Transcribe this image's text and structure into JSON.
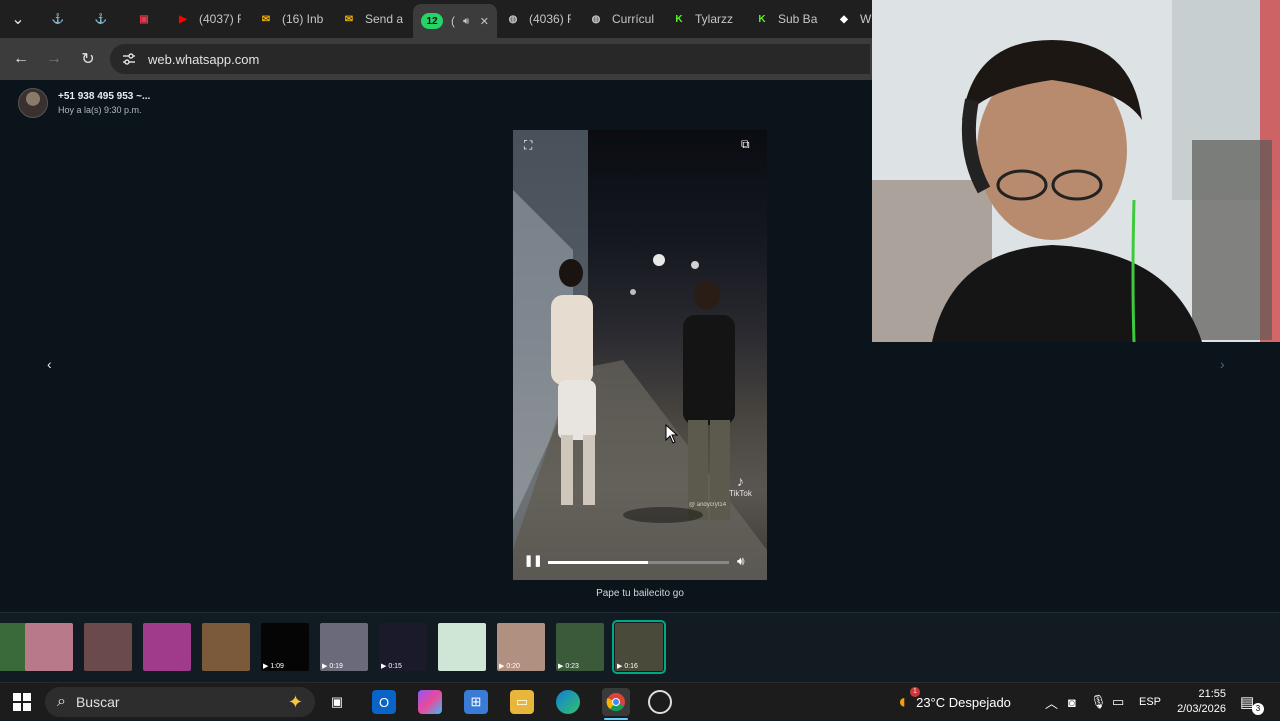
{
  "browser": {
    "tabs": [
      {
        "label": "",
        "icon": "anchor-icon",
        "color": "#ffffff"
      },
      {
        "label": "",
        "icon": "anchor-icon",
        "color": "#ffffff"
      },
      {
        "label": "",
        "icon": "app-icon",
        "color": "#e8364b"
      },
      {
        "label": "(4037) F",
        "icon": "youtube-icon",
        "color": "#ff0000"
      },
      {
        "label": "(16) Inb",
        "icon": "mail-icon",
        "color": "#f4b400"
      },
      {
        "label": "Send a",
        "icon": "mail-icon",
        "color": "#f4b400"
      },
      {
        "label": "(",
        "icon": "whatsapp-icon",
        "color": "#25d366",
        "badge": "12",
        "active": true
      },
      {
        "label": "(4036) F",
        "icon": "globe-icon",
        "color": "#c4c7c5"
      },
      {
        "label": "Currícul",
        "icon": "globe-icon",
        "color": "#c4c7c5"
      },
      {
        "label": "Tylarzz",
        "icon": "kick-icon",
        "color": "#53fc18"
      },
      {
        "label": "Sub Ba",
        "icon": "kick-icon",
        "color": "#53fc18"
      },
      {
        "label": "Wi",
        "icon": "diamond-icon",
        "color": "#ffffff"
      }
    ],
    "url": "web.whatsapp.com"
  },
  "viewer": {
    "sender_name": "+51 938 495 953 ~...",
    "sender_time": "Hoy a la(s) 9:30 p.m.",
    "caption": "Pape tu bailecito go",
    "video": {
      "watermark": "TikTok",
      "handle": "@ andycryt14",
      "progress": 0.55
    }
  },
  "thumbnails": [
    {
      "duration": "",
      "color": "#3a6a3a"
    },
    {
      "duration": "",
      "color": "#b87a8a"
    },
    {
      "duration": "",
      "color": "#6a4a4a"
    },
    {
      "duration": "",
      "color": "#a03a8a"
    },
    {
      "duration": "",
      "color": "#7a5a3a"
    },
    {
      "duration": "1:09",
      "color": "#050505"
    },
    {
      "duration": "0:19",
      "color": "#6a6a7a"
    },
    {
      "duration": "0:15",
      "color": "#1a1a2a"
    },
    {
      "duration": "",
      "color": "#cfe6d6"
    },
    {
      "duration": "0:20",
      "color": "#b09080"
    },
    {
      "duration": "0:23",
      "color": "#3a5a3a"
    },
    {
      "duration": "0:16",
      "color": "#4a4a3a",
      "selected": true
    }
  ],
  "taskbar": {
    "search_label": "Buscar",
    "weather": "23°C  Despejado",
    "language": "ESP",
    "time": "21:55",
    "date": "2/03/2026",
    "notif_count": "3",
    "weather_badge": "1"
  }
}
